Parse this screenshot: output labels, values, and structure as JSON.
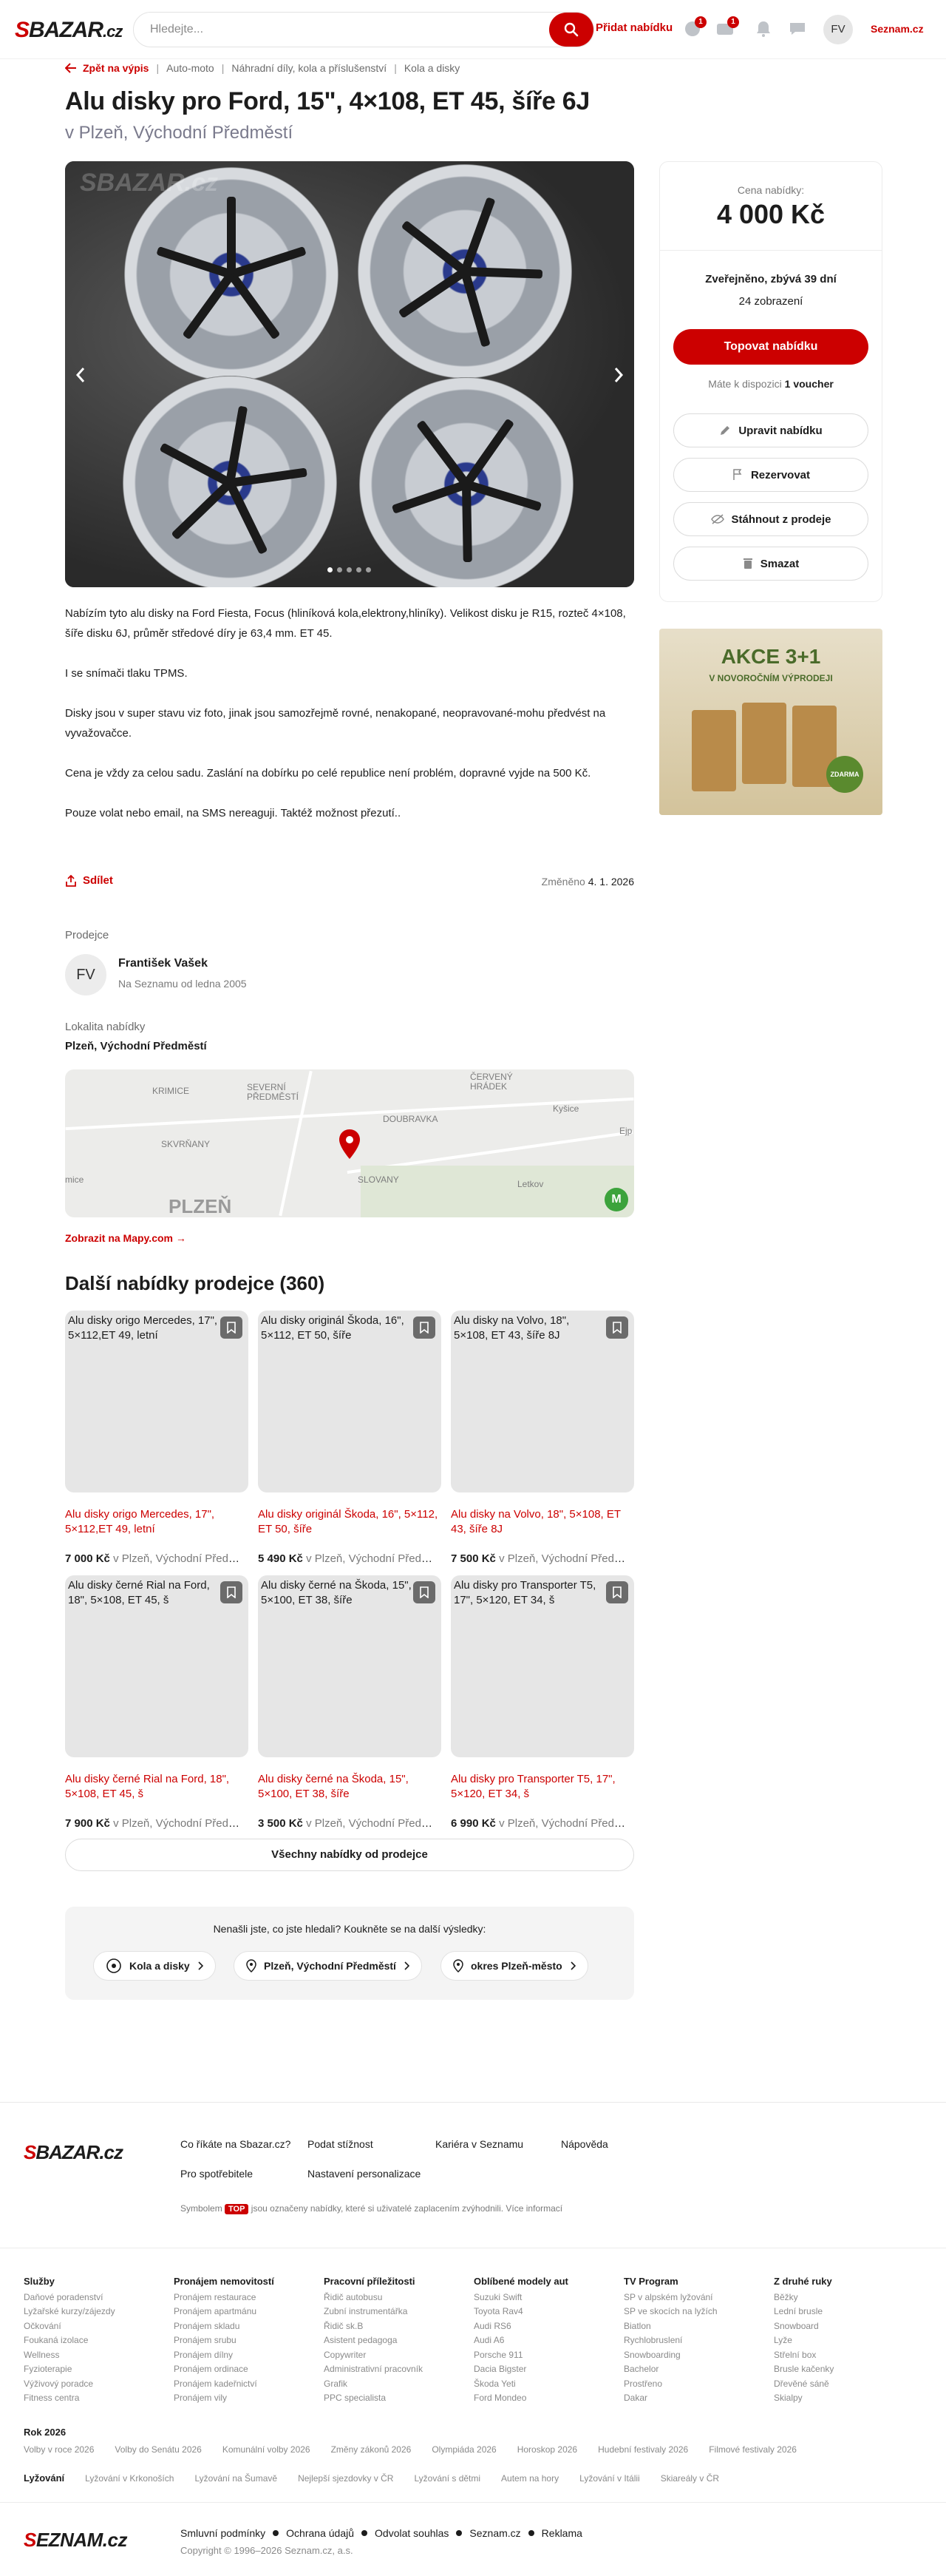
{
  "header": {
    "logo": "SBAZAR.cz",
    "search_placeholder": "Hledejte...",
    "add_offer": "Přidat nabídku",
    "badges": [
      "1",
      "1"
    ],
    "avatar_initials": "FV",
    "seznam_link": "Seznam.cz"
  },
  "breadcrumb": {
    "back": "Zpět na výpis",
    "items": [
      "Auto-moto",
      "Náhradní díly, kola a příslušenství",
      "Kola a disky"
    ]
  },
  "listing": {
    "title": "Alu disky pro Ford, 15\", 4×108, ET 45, šíře 6J",
    "location": "v Plzeň, Východní Předměstí",
    "watermark": "SBAZAR.cz",
    "description": [
      "Nabízím tyto alu disky na Ford Fiesta, Focus (hliníková kola,elektrony,hliníky). Velikost disku je R15, rozteč 4×108, šíře disku 6J, průměr středové díry je 63,4 mm. ET 45.",
      "I se snímači tlaku TPMS.",
      "Disky jsou v super stavu viz foto, jinak jsou samozřejmě rovné, nenakopané, neopravované-mohu předvést na vyvažovačce.",
      "Cena je vždy za celou sadu. Zaslání na dobírku po celé republice není problém, dopravné vyjde na 500 Kč.",
      "Pouze volat nebo email, na SMS nereaguji. Taktéž možnost přezutí.."
    ],
    "share": "Sdílet",
    "changed_label": "Změněno",
    "changed_date": "4. 1. 2026"
  },
  "seller": {
    "heading": "Prodejce",
    "initials": "FV",
    "name": "František Vašek",
    "since": "Na Seznamu od ledna 2005",
    "location_heading": "Lokalita nabídky",
    "location": "Plzeň, Východní Předměstí",
    "map_link": "Zobrazit na Mapy.com →",
    "map_labels": [
      "KRIMICE",
      "SEVERNÍ PŘEDMĚSTÍ",
      "ČERVENÝ HRÁDEK",
      "SKVRŇANY",
      "DOUBRAVKA",
      "Kyšice",
      "Ejp",
      "mice",
      "SLOVANY",
      "Letkov",
      "PLZEŇ"
    ]
  },
  "more": {
    "heading": "Další nabídky prodejce (360)",
    "cards": [
      {
        "alt": "Alu disky origo Mercedes, 17\", 5×112,ET 49, letní",
        "title": "Alu disky origo Mercedes, 17\", 5×112,ET 49, letní",
        "price": "7 000 Kč",
        "loc": "v Plzeň, Východní Předměstí"
      },
      {
        "alt": "Alu disky originál Škoda, 16\", 5×112, ET 50, šíře",
        "title": "Alu disky originál Škoda, 16\", 5×112, ET 50, šíře",
        "price": "5 490 Kč",
        "loc": "v Plzeň, Východní Předměstí"
      },
      {
        "alt": "Alu disky na Volvo, 18\", 5×108, ET 43, šíře 8J",
        "title": "Alu disky na Volvo, 18\", 5×108, ET 43, šíře 8J",
        "price": "7 500 Kč",
        "loc": "v Plzeň, Východní Předměstí"
      },
      {
        "alt": "Alu disky černé Rial na Ford, 18\", 5×108, ET 45, š",
        "title": "Alu disky černé Rial na Ford, 18\", 5×108, ET 45, š",
        "price": "7 900 Kč",
        "loc": "v Plzeň, Východní Předměstí"
      },
      {
        "alt": "Alu disky černé na Škoda, 15\", 5×100, ET 38, šíře",
        "title": "Alu disky černé na Škoda, 15\", 5×100, ET 38, šíře",
        "price": "3 500 Kč",
        "loc": "v Plzeň, Východní Předměstí"
      },
      {
        "alt": "Alu disky pro Transporter T5, 17\", 5×120, ET 34, š",
        "title": "Alu disky pro Transporter T5, 17\", 5×120, ET 34, š",
        "price": "6 990 Kč",
        "loc": "v Plzeň, Východní Předměstí"
      }
    ],
    "all_button": "Všechny nabídky od prodejce"
  },
  "notfound": {
    "question": "Nenašli jste, co jste hledali? Koukněte se na další výsledky:",
    "chips": [
      "Kola a disky",
      "Plzeň, Východní Předměstí",
      "okres Plzeň-město"
    ]
  },
  "sidebar": {
    "price_label": "Cena nabídky:",
    "price": "4 000 Kč",
    "published": "Zveřejněno, zbývá 39 dní",
    "views": "24 zobrazení",
    "top_button": "Topovat nabídku",
    "voucher_text": "Máte k dispozici",
    "voucher_count": "1 voucher",
    "buttons": [
      "Upravit nabídku",
      "Rezervovat",
      "Stáhnout z prodeje",
      "Smazat"
    ]
  },
  "ad": {
    "title": "AKCE 3+1",
    "subtitle": "V NOVOROČNÍM VÝPRODEJI",
    "tag": "ZDARMA"
  },
  "footer": {
    "logo": "SBAZAR.cz",
    "links": [
      "Co říkáte na Sbazar.cz?",
      "Podat stížnost",
      "Kariéra v Seznamu",
      "Nápověda",
      "Pro spotřebitele",
      "Nastavení personalizace"
    ],
    "note_before": "Symbolem",
    "note_badge": "TOP",
    "note_after": "jsou označeny nabídky, které si uživatelé zaplacením zvýhodnili. Více informací",
    "columns": [
      {
        "h": "Služby",
        "items": [
          "Daňové poradenství",
          "Lyžařské kurzy/zájezdy",
          "Očkování",
          "Foukaná izolace",
          "Wellness",
          "Fyzioterapie",
          "Výživový poradce",
          "Fitness centra"
        ]
      },
      {
        "h": "Pronájem nemovitostí",
        "items": [
          "Pronájem restaurace",
          "Pronájem apartmánu",
          "Pronájem skladu",
          "Pronájem srubu",
          "Pronájem dílny",
          "Pronájem ordinace",
          "Pronájem kadeřnictví",
          "Pronájem vily"
        ]
      },
      {
        "h": "Pracovní příležitosti",
        "items": [
          "Řidič autobusu",
          "Zubní instrumentářka",
          "Řidič sk.B",
          "Asistent pedagoga",
          "Copywriter",
          "Administrativní pracovník",
          "Grafik",
          "PPC specialista"
        ]
      },
      {
        "h": "Oblíbené modely aut",
        "items": [
          "Suzuki Swift",
          "Toyota Rav4",
          "Audi RS6",
          "Audi A6",
          "Porsche 911",
          "Dacia Bigster",
          "Škoda Yeti",
          "Ford Mondeo"
        ]
      },
      {
        "h": "TV Program",
        "items": [
          "SP v alpském lyžování",
          "SP ve skocích na lyžích",
          "Biatlon",
          "Rychlobruslení",
          "Snowboarding",
          "Bachelor",
          "Prostřeno",
          "Dakar"
        ]
      },
      {
        "h": "Z druhé ruky",
        "items": [
          "Běžky",
          "Lední brusle",
          "Snowboard",
          "Lyže",
          "Střelní box",
          "Brusle kačenky",
          "Dřevěné sáně",
          "Skialpy"
        ]
      }
    ],
    "year_heading": "Rok 2026",
    "year_items": [
      "Volby v roce 2026",
      "Volby do Senátu 2026",
      "Komunální volby 2026",
      "Změny zákonů 2026",
      "Olympiáda 2026",
      "Horoskop 2026",
      "Hudební festivaly 2026",
      "Filmové festivaly 2026"
    ],
    "ski_label": "Lyžování",
    "ski_items": [
      "Lyžování v Krkonoších",
      "Lyžování na Šumavě",
      "Nejlepší sjezdovky v ČR",
      "Lyžování s dětmi",
      "Autem na hory",
      "Lyžování v Itálii",
      "Skiareály v ČR"
    ],
    "seznam_logo": "SEZNAM.cz",
    "legal": [
      "Smluvní podmínky",
      "Ochrana údajů",
      "Odvolat souhlas",
      "Seznam.cz",
      "Reklama"
    ],
    "copyright": "Copyright © 1996–2026 Seznam.cz, a.s."
  }
}
